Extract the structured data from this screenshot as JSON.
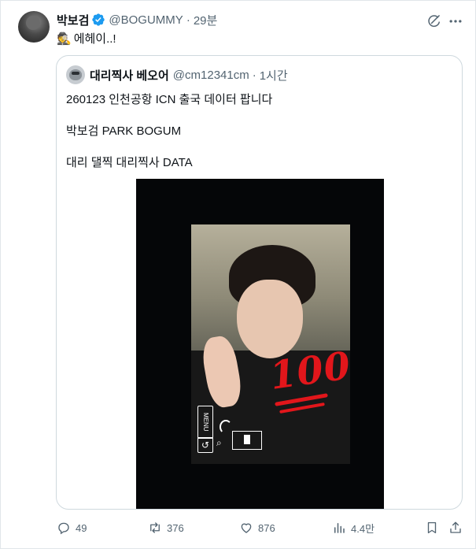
{
  "post": {
    "author_name": "박보검",
    "author_handle": "@BOGUMMY",
    "separator": "·",
    "time_ago": "29분",
    "emoji": "🕵",
    "text": "에헤이..!"
  },
  "quote": {
    "author_name": "대리찍사 베오어",
    "author_handle": "@cm12341cm",
    "separator": "·",
    "time_ago": "1시간",
    "line1": "260123 인천공항 ICN 출국 데이터 팝니다",
    "line2": "박보검 PARK BOGUM",
    "line3": "대리 댈찍 대리찍사  DATA",
    "image": {
      "overlay_emoji": "💯",
      "overlay_text": "100",
      "camera_menu_label": "MENU",
      "camera_return_icon": "↺"
    }
  },
  "actions": {
    "replies": "49",
    "reposts": "376",
    "likes": "876",
    "views": "4.4만"
  },
  "colors": {
    "muted": "#536471",
    "verified": "#1d9bf0",
    "text": "#0f1419",
    "border": "#cfd9de",
    "overlay_red": "#e2161b"
  },
  "icons": {
    "verified": "verified-badge-icon",
    "grok": "grok-icon",
    "more": "more-icon",
    "reply": "reply-icon",
    "repost": "repost-icon",
    "like": "heart-icon",
    "views": "views-icon",
    "bookmark": "bookmark-icon",
    "share": "share-icon"
  }
}
